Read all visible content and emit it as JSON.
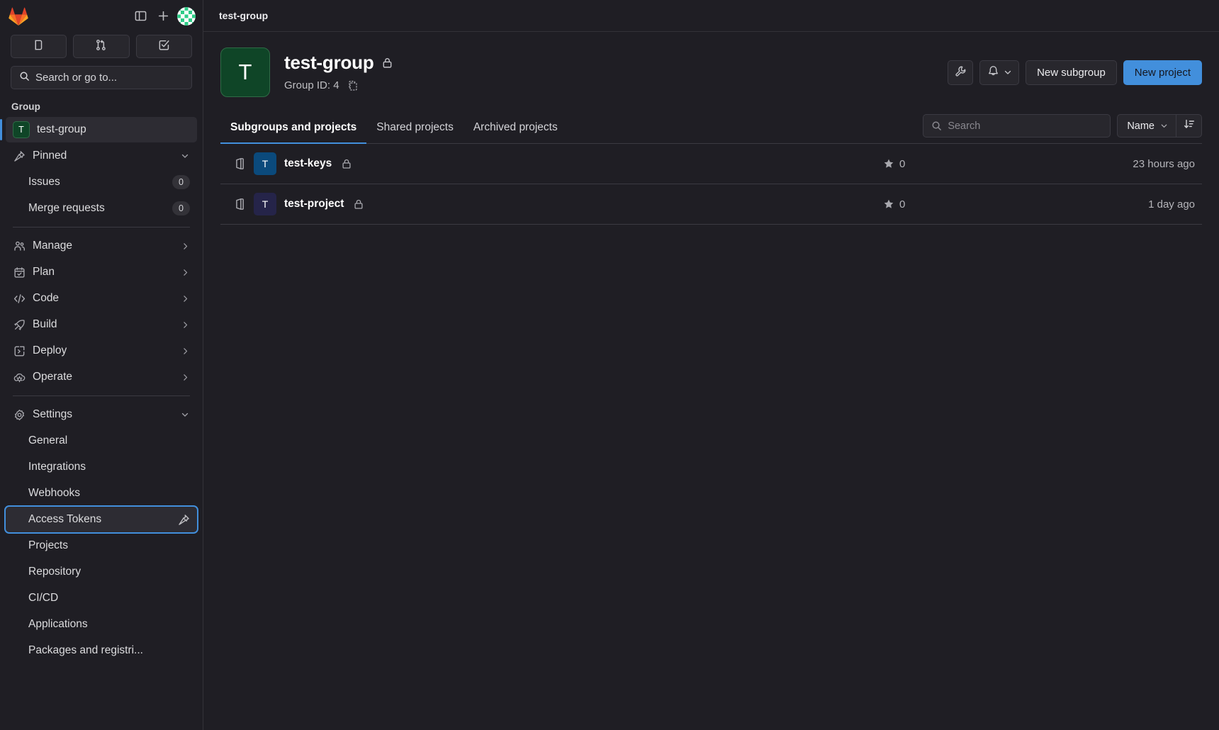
{
  "colors": {
    "accent_blue": "#428fdc",
    "page_bg": "#1f1e24",
    "surface": "#28272d",
    "border": "#3b3a42",
    "group_avatar_green": "#0f4527",
    "test_keys_avatar": "#0b4a7c",
    "test_project_avatar": "#252449"
  },
  "sidebar": {
    "logo_icon": "gitlab-logo-icon",
    "toggle_icon": "sidebar-toggle-icon",
    "create_icon": "plus-icon",
    "avatar_icon": "user-avatar-identicon",
    "quick_buttons": [
      {
        "name": "issues",
        "icon": "issues-icon"
      },
      {
        "name": "merge-requests",
        "icon": "merge-request-icon"
      },
      {
        "name": "to-do",
        "icon": "todo-checkbox-icon"
      }
    ],
    "search": {
      "label": "Search or go to...",
      "icon": "search-icon"
    },
    "section_label": "Group",
    "context": {
      "label": "test-group",
      "avatar_initial": "T"
    },
    "pinned": {
      "label": "Pinned",
      "icon": "pin-icon",
      "chevron": "chevron-down-icon"
    },
    "pinned_items": [
      {
        "label": "Issues",
        "count": "0"
      },
      {
        "label": "Merge requests",
        "count": "0"
      }
    ],
    "nav_items": [
      {
        "label": "Manage",
        "icon": "users-icon",
        "chevron": "chevron-right-icon"
      },
      {
        "label": "Plan",
        "icon": "calendar-icon",
        "chevron": "chevron-right-icon"
      },
      {
        "label": "Code",
        "icon": "code-icon",
        "chevron": "chevron-right-icon"
      },
      {
        "label": "Build",
        "icon": "rocket-icon",
        "chevron": "chevron-right-icon"
      },
      {
        "label": "Deploy",
        "icon": "deploy-icon",
        "chevron": "chevron-right-icon"
      },
      {
        "label": "Operate",
        "icon": "cloud-operate-icon",
        "chevron": "chevron-right-icon"
      }
    ],
    "settings": {
      "label": "Settings",
      "icon": "gear-icon",
      "chevron": "chevron-down-icon"
    },
    "settings_items": [
      {
        "label": "General",
        "focused": false
      },
      {
        "label": "Integrations",
        "focused": false
      },
      {
        "label": "Webhooks",
        "focused": false
      },
      {
        "label": "Access Tokens",
        "focused": true,
        "pin_icon": "pin-icon"
      },
      {
        "label": "Projects",
        "focused": false
      },
      {
        "label": "Repository",
        "focused": false
      },
      {
        "label": "CI/CD",
        "focused": false
      },
      {
        "label": "Applications",
        "focused": false
      },
      {
        "label": "Packages and registri...",
        "focused": false
      }
    ]
  },
  "breadcrumb": {
    "text": "test-group"
  },
  "group_header": {
    "avatar_initial": "T",
    "title": "test-group",
    "visibility_icon": "lock-icon",
    "group_id": "Group ID: 4",
    "copy_icon": "copy-to-clipboard-icon",
    "actions": {
      "wrench_icon": "wrench-icon",
      "bell_icon": "bell-notification-icon",
      "bell_chevron": "chevron-down-icon",
      "new_subgroup": "New subgroup",
      "new_project": "New project"
    }
  },
  "tabs": [
    {
      "label": "Subgroups and projects",
      "active": true
    },
    {
      "label": "Shared projects",
      "active": false
    },
    {
      "label": "Archived projects",
      "active": false
    }
  ],
  "toolbar": {
    "search_placeholder": "Search",
    "search_value": "",
    "search_icon": "search-icon",
    "sort_label": "Name",
    "sort_chevron": "chevron-down-icon",
    "sort_direction_icon": "sort-descending-icon"
  },
  "projects": [
    {
      "nested_icon": "nested-namespace-icon",
      "avatar_initial": "T",
      "avatar_color": "#0b4a7c",
      "name": "test-keys",
      "visibility_icon": "lock-icon",
      "star_icon": "star-icon",
      "stars": "0",
      "updated": "23 hours ago"
    },
    {
      "nested_icon": "nested-namespace-icon",
      "avatar_initial": "T",
      "avatar_color": "#252449",
      "name": "test-project",
      "visibility_icon": "lock-icon",
      "star_icon": "star-icon",
      "stars": "0",
      "updated": "1 day ago"
    }
  ]
}
